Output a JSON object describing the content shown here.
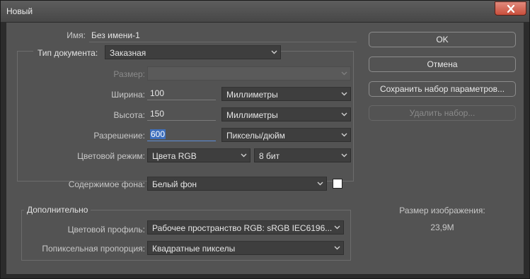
{
  "window": {
    "title": "Новый",
    "close_icon": "close-icon"
  },
  "name_field": {
    "label": "Имя:",
    "value": "Без имени-1"
  },
  "document_type": {
    "label": "Тип документа:",
    "value": "Заказная"
  },
  "size": {
    "label": "Размер:",
    "value": ""
  },
  "width": {
    "label": "Ширина:",
    "value": "100",
    "unit": "Миллиметры"
  },
  "height": {
    "label": "Высота:",
    "value": "150",
    "unit": "Миллиметры"
  },
  "resolution": {
    "label": "Разрешение:",
    "value": "600",
    "unit": "Пикселы/дюйм"
  },
  "color_mode": {
    "label": "Цветовой режим:",
    "value": "Цвета RGB",
    "depth": "8 бит"
  },
  "background": {
    "label": "Содержимое фона:",
    "value": "Белый фон",
    "swatch_color": "#ffffff"
  },
  "advanced": {
    "legend": "Дополнительно",
    "profile": {
      "label": "Цветовой профиль:",
      "value": "Рабочее пространство RGB:  sRGB IEC6196..."
    },
    "pixel_aspect": {
      "label": "Попиксельная пропорция:",
      "value": "Квадратные пикселы"
    }
  },
  "buttons": {
    "ok": "OK",
    "cancel": "Отмена",
    "save_preset": "Сохранить набор параметров...",
    "delete_preset": "Удалить набор..."
  },
  "image_size": {
    "label": "Размер изображения:",
    "value": "23,9M"
  }
}
